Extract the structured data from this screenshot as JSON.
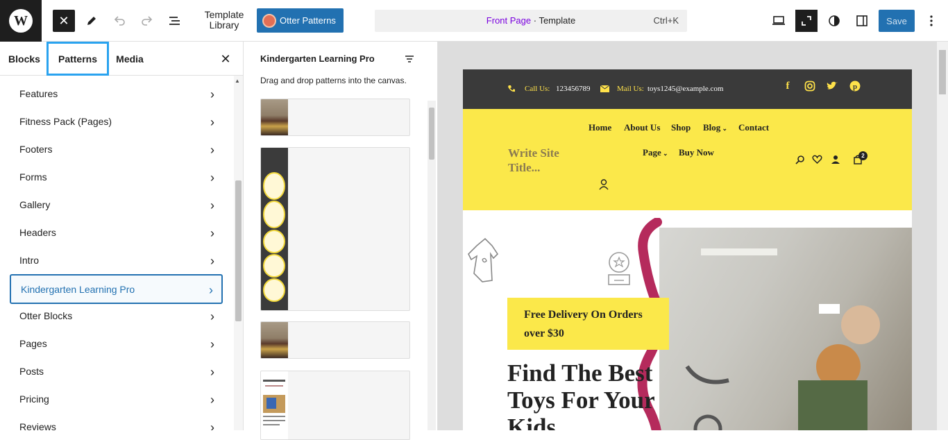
{
  "topbar": {
    "logo": "W",
    "template_library": "Template Library",
    "otter_patterns": "Otter Patterns",
    "command": {
      "page": "Front Page",
      "sep": " · ",
      "type": "Template",
      "shortcut": "Ctrl+K"
    },
    "save": "Save"
  },
  "sidebar": {
    "tabs": [
      "Blocks",
      "Patterns",
      "Media"
    ],
    "active_tab": "Patterns",
    "categories": [
      "Features",
      "Fitness Pack (Pages)",
      "Footers",
      "Forms",
      "Gallery",
      "Headers",
      "Intro",
      "Kindergarten Learning Pro",
      "Otter Blocks",
      "Pages",
      "Posts",
      "Pricing",
      "Reviews"
    ],
    "selected_category": "Kindergarten Learning Pro"
  },
  "patterns_panel": {
    "title": "Kindergarten Learning Pro",
    "description": "Drag and drop patterns into the canvas."
  },
  "canvas": {
    "top_bar": {
      "call_label": "Call Us:",
      "call_value": "123456789",
      "mail_label": "Mail Us:",
      "mail_value": "toys1245@example.com"
    },
    "nav": [
      "Home",
      "About Us",
      "Shop",
      "Blog",
      "Contact",
      "Page",
      "Buy Now"
    ],
    "site_title": "Write Site Title...",
    "cart_count": "2",
    "promo": "Free Delivery On Orders over $30",
    "hero_heading": "Find The Best Toys For Your Kids"
  },
  "colors": {
    "accent": "#2271b1",
    "selection": "#2aa3ef",
    "site_yellow": "#fbe84a",
    "site_dark": "#3a3a3a",
    "page_link": "#7a00df"
  }
}
